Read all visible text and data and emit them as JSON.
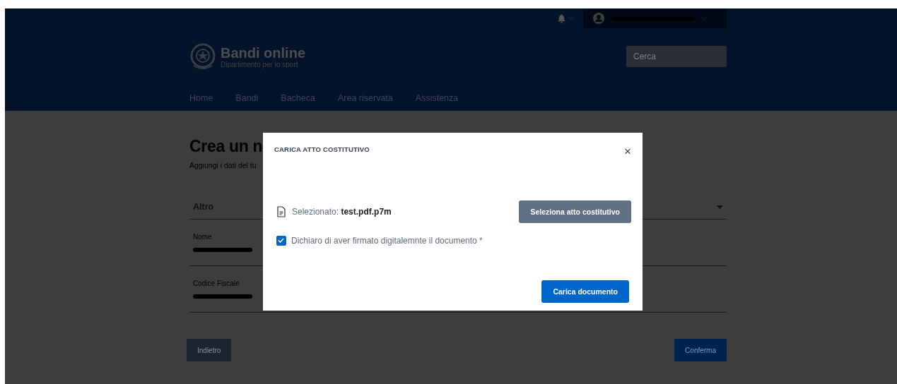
{
  "header": {
    "brand": {
      "title": "Bandi online",
      "subtitle": "Dipartimento per lo sport"
    },
    "search": {
      "placeholder": "Cerca"
    },
    "nav": [
      {
        "label": "Home"
      },
      {
        "label": "Bandi"
      },
      {
        "label": "Bacheca"
      },
      {
        "label": "Area riservata"
      },
      {
        "label": "Assistenza"
      }
    ]
  },
  "form": {
    "title": "Crea un n",
    "subtitle": "Aggiungi i dati del tu",
    "select": {
      "value": "Altro"
    },
    "fields": [
      {
        "label": "Nome"
      },
      {
        "label": "Codice Fiscale"
      }
    ],
    "buttons": [
      {
        "label": "Indietro",
        "kind": "secondary"
      },
      {
        "label": "Conferma",
        "kind": "primary"
      }
    ]
  },
  "modal": {
    "title": "CARICA ATTO COSTITUTIVO",
    "close": "×",
    "selected_file": "Selezionato: **test.pdf.p7m**",
    "select_button": "Seleziona atto costitutivo",
    "declaration": {
      "label": "Dichiaro di aver firmato digitalemnte il documento *",
      "checked": true
    },
    "submit_button": "Carica documento"
  }
}
